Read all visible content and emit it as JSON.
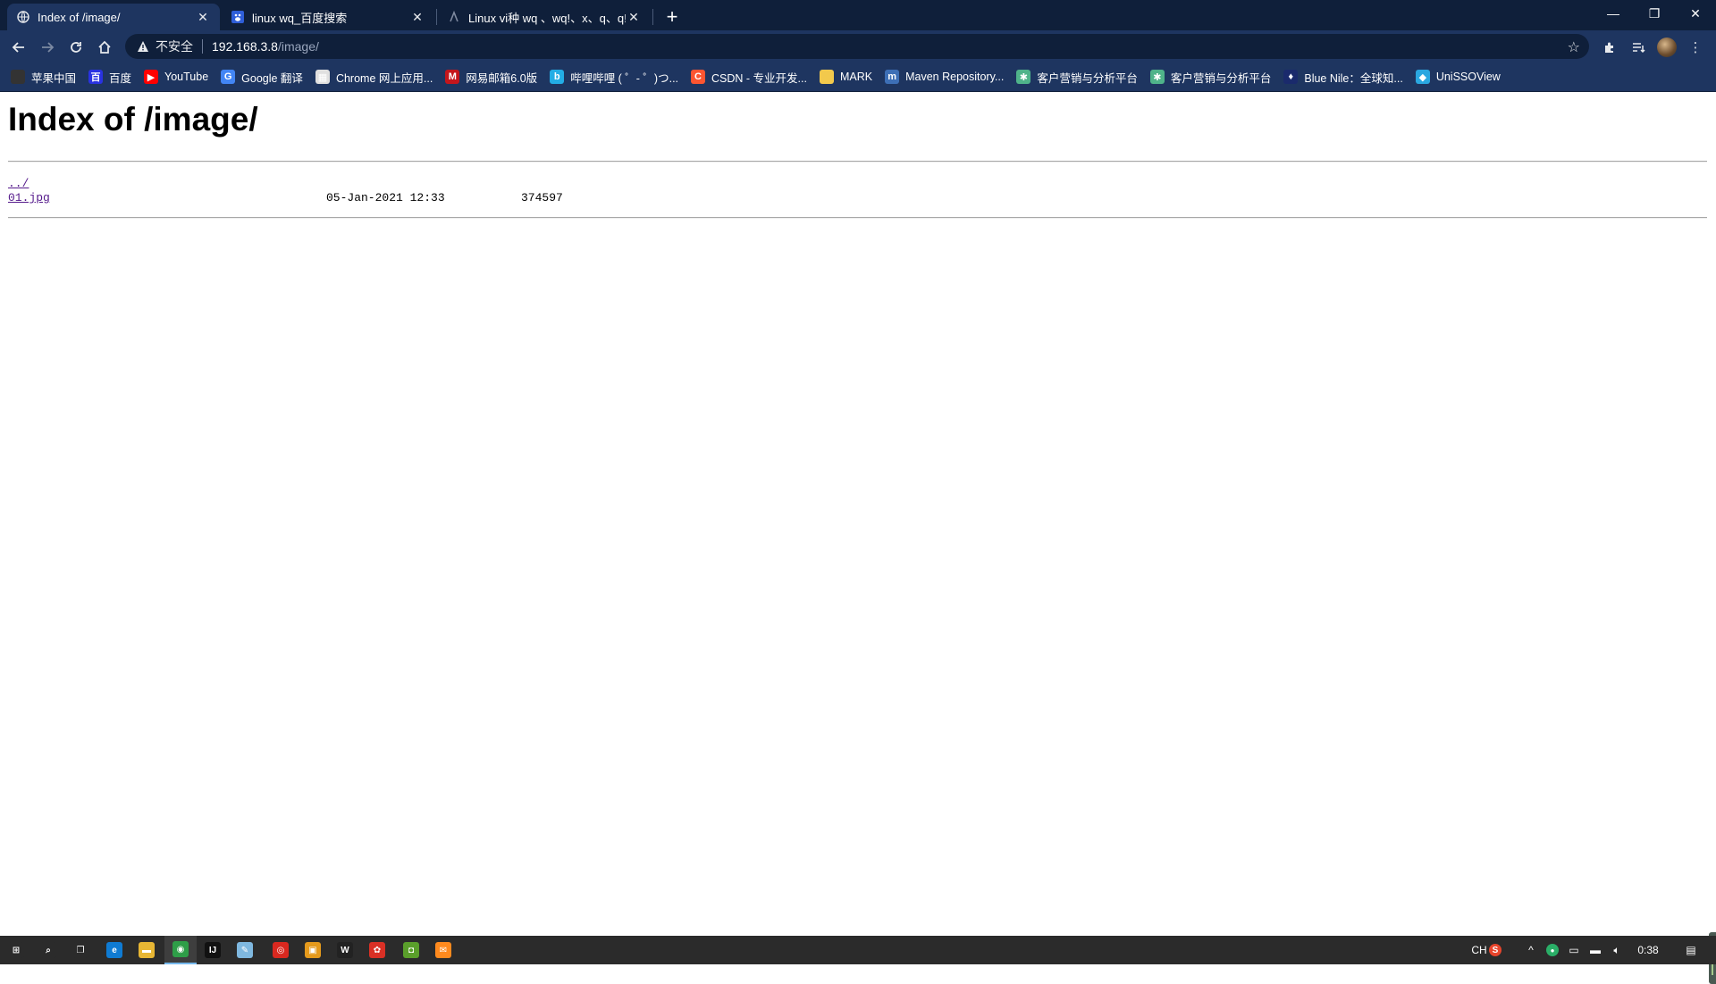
{
  "browser": {
    "tabs": [
      {
        "title": "Index of /image/",
        "active": true
      },
      {
        "title": "linux wq_百度搜索",
        "active": false
      },
      {
        "title": "Linux vi种 wq 、wq!、x、q、q!",
        "active": false
      }
    ],
    "tab_close_glyph": "✕",
    "new_tab_glyph": "+",
    "window_controls": {
      "minimize": "—",
      "restore": "❐",
      "close": "✕"
    },
    "omnibox": {
      "insecure_label": "不安全",
      "host": "192.168.3.8",
      "path": "/image/"
    },
    "bookmarks": [
      {
        "label": "苹果中国",
        "icon": "apple-icon",
        "color": "#333333",
        "glyph": ""
      },
      {
        "label": "百度",
        "icon": "baidu-icon",
        "color": "#2932e1",
        "glyph": "百"
      },
      {
        "label": "YouTube",
        "icon": "youtube-icon",
        "color": "#ff0000",
        "glyph": "▶"
      },
      {
        "label": "Google 翻译",
        "icon": "google-translate-icon",
        "color": "#4285f4",
        "glyph": "G"
      },
      {
        "label": "Chrome 网上应用...",
        "icon": "chrome-webstore-icon",
        "color": "#e0e0e0",
        "glyph": "▦"
      },
      {
        "label": "网易邮箱6.0版",
        "icon": "netease-mail-icon",
        "color": "#c4161c",
        "glyph": "M"
      },
      {
        "label": "哔哩哔哩 ( ゜- ゜)つ...",
        "icon": "bilibili-icon",
        "color": "#23ade5",
        "glyph": "b"
      },
      {
        "label": "CSDN - 专业开发...",
        "icon": "csdn-icon",
        "color": "#fc5531",
        "glyph": "C"
      },
      {
        "label": "MARK",
        "icon": "folder-icon",
        "color": "#f2c94c",
        "glyph": ""
      },
      {
        "label": "Maven Repository...",
        "icon": "maven-icon",
        "color": "#3d6fb6",
        "glyph": "m"
      },
      {
        "label": "客户营销与分析平台",
        "icon": "platform-icon",
        "color": "#4fb38a",
        "glyph": "✱"
      },
      {
        "label": "客户营销与分析平台",
        "icon": "platform-icon",
        "color": "#4fb38a",
        "glyph": "✱"
      },
      {
        "label": "Blue Nile：全球知...",
        "icon": "bluenile-icon",
        "color": "#1a2a6c",
        "glyph": "♦"
      },
      {
        "label": "UniSSOView",
        "icon": "unissoview-icon",
        "color": "#2aa7e0",
        "glyph": "◆"
      }
    ]
  },
  "page": {
    "heading": "Index of /image/",
    "entries": [
      {
        "name": "../",
        "date": "",
        "size": ""
      },
      {
        "name": "01.jpg",
        "date": "05-Jan-2021 12:33",
        "size": "374597"
      }
    ]
  },
  "taskbar": {
    "apps": [
      {
        "name": "windows-start-icon",
        "glyph": "⊞",
        "color": "#2b2b2b"
      },
      {
        "name": "search-icon",
        "glyph": "⌕",
        "color": "#2b2b2b"
      },
      {
        "name": "task-view-icon",
        "glyph": "❐",
        "color": "#2b2b2b"
      },
      {
        "name": "edge-icon",
        "glyph": "e",
        "color": "#0f7bd3"
      },
      {
        "name": "file-explorer-icon",
        "glyph": "▬",
        "color": "#e7b634"
      },
      {
        "name": "chrome-icon",
        "glyph": "◉",
        "color": "#2e9e48"
      },
      {
        "name": "intellij-icon",
        "glyph": "IJ",
        "color": "#111111"
      },
      {
        "name": "notepad-icon",
        "glyph": "✎",
        "color": "#7fb8e0"
      },
      {
        "name": "netease-music-icon",
        "glyph": "◎",
        "color": "#d9281f"
      },
      {
        "name": "taskbar-app-icon",
        "glyph": "▣",
        "color": "#e59a1c"
      },
      {
        "name": "wps-icon",
        "glyph": "W",
        "color": "#222222"
      },
      {
        "name": "taskbar-app-icon",
        "glyph": "✿",
        "color": "#d93025"
      },
      {
        "name": "taskbar-app-icon",
        "glyph": "◘",
        "color": "#5a9f2b"
      },
      {
        "name": "wechat-icon",
        "glyph": "✉",
        "color": "#ff8a1e"
      }
    ],
    "tray": {
      "ime": "CH",
      "clock": "0:38"
    }
  }
}
